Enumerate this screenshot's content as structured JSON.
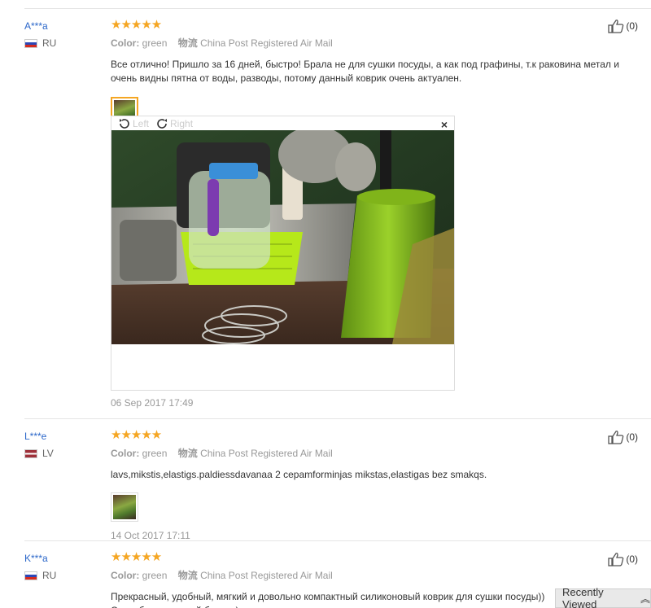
{
  "reviews": [
    {
      "user": "A***a",
      "country": "RU",
      "stars": "★★★★★",
      "color_label": "Color:",
      "color_value": "green",
      "shipping_label": "物流",
      "shipping_value": "China Post Registered Air Mail",
      "text": "Все отлично! Пришло за 16 дней, быстро! Брала не для сушки посуды, а как под графины, т.к раковина метал и очень видны пятна от воды, разводы, потому данный коврик очень актуален.",
      "date": "06 Sep 2017 17:49",
      "helpful_count": "(0)"
    },
    {
      "user": "L***e",
      "country": "LV",
      "stars": "★★★★★",
      "color_label": "Color:",
      "color_value": "green",
      "shipping_label": "物流",
      "shipping_value": "China Post Registered Air Mail",
      "text": "lavs,mikstis,elastigs.paldiessdavanaa 2 cepamforminjas mikstas,elastigas bez smakqs.",
      "date": "14 Oct 2017 17:11",
      "helpful_count": "(0)"
    },
    {
      "user": "K***a",
      "country": "RU",
      "stars": "★★★★★",
      "color_label": "Color:",
      "color_value": "green",
      "shipping_label": "物流",
      "shipping_value": "China Post Registered Air Mail",
      "text": "Прекрасный, удобный, мягкий и довольно компактный силиконовый коврик для сушки посуды)) Спасибо маленький бонус :)",
      "helpful_count": "(0)"
    }
  ],
  "viewer": {
    "rotate_left": "Left",
    "rotate_right": "Right",
    "close": "×"
  },
  "recently_viewed": {
    "label": "Recently Viewed",
    "chevron": "︽"
  }
}
